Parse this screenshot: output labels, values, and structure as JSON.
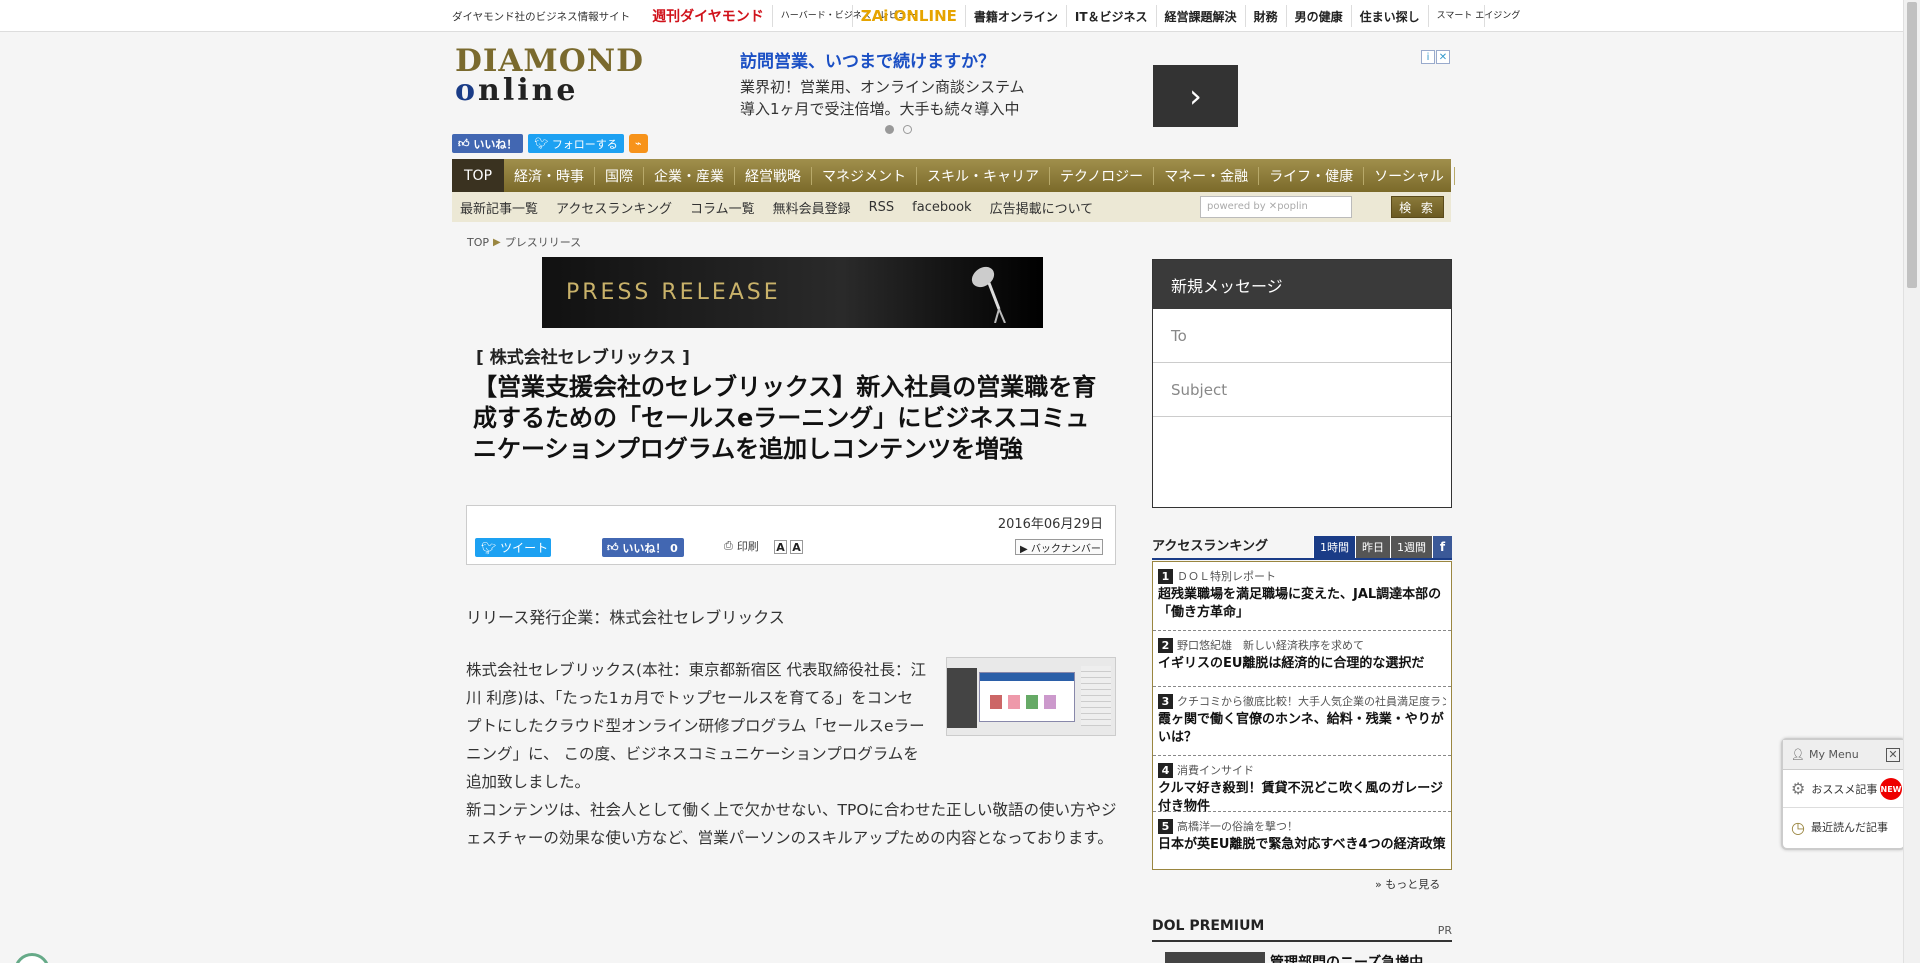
{
  "topbar": {
    "site_label": "ダイヤモンド社のビジネス情報サイト",
    "links": [
      "週刊ダイヤモンド",
      "ハーバード・ビジネス・レビュー",
      "ZAi ONLINE",
      "書籍オンライン",
      "IT＆ビジネス",
      "経営課題解決",
      "財務",
      "男の健康",
      "住まい探し",
      "スマート エイジング"
    ]
  },
  "logo": {
    "line1": "DIAMOND",
    "line2_a": "o",
    "line2_b": "nline"
  },
  "social": {
    "like": "いいね！",
    "follow": "フォローする",
    "rss": "RSS"
  },
  "ad": {
    "headline": "訪問営業、いつまで続けますか？",
    "line1": "業界初！営業用、オンライン商談システム",
    "line2": "導入1ヶ月で受注倍増。大手も続々導入中",
    "arrow": "›",
    "info": "i",
    "close": "✕"
  },
  "nav": {
    "items": [
      "TOP",
      "経済・時事",
      "国際",
      "企業・産業",
      "経営戦略",
      "マネジメント",
      "スキル・キャリア",
      "テクノロジー",
      "マネー・金融",
      "ライフ・健康",
      "ソーシャル"
    ]
  },
  "subnav": {
    "items": [
      "最新記事一覧",
      "アクセスランキング",
      "コラム一覧",
      "無料会員登録",
      "RSS",
      "facebook",
      "広告掲載について"
    ],
    "search_placeholder": "powered by ✕poplin",
    "search_button": "検 索"
  },
  "breadcrumb": {
    "home": "TOP",
    "sep": "▶",
    "current": "プレスリリース"
  },
  "press_banner": "PRESS RELEASE",
  "article": {
    "company": "[ 株式会社セレブリックス ]",
    "title": "【営業支援会社のセレブリックス】新入社員の営業職を育成するための「セールスeラーニング」にビジネスコミュニケーションプログラムを追加しコンテンツを増強",
    "date": "2016年06月29日",
    "tweet": "ツイート",
    "like": "いいね！ 0",
    "print": "印刷",
    "font_a1": "A",
    "font_a2": "A",
    "backnumber": "▶ バックナンバー",
    "issuer": "リリース発行企業：株式会社セレブリックス",
    "p1": "株式会社セレブリックス(本社：東京都新宿区 代表取締役社長：江川 利彦)は、「たった1ヵ月でトップセールスを育てる」をコンセプトにしたクラウド型オンライン研修プログラム「セールスeラーニング」に、 この度、ビジネスコミュニケーションプログラムを追加致しました。",
    "p2": "新コンテンツは、社会人として働く上で欠かせない、TPOに合わせた正しい敬語の使い方やジェスチャーの効果な使い方など、営業パーソンのスキルアップための内容となっております。"
  },
  "message": {
    "title": "新規メッセージ",
    "to": "To",
    "subject": "Subject"
  },
  "ranking": {
    "title": "アクセスランキング",
    "tabs": [
      "1時間",
      "昨日",
      "1週間"
    ],
    "fb": "f",
    "items": [
      {
        "num": "1",
        "series": "ＤＯＬ特別レポート",
        "title": "超残業職場を満足職場に変えた、JAL調達本部の「働き方革命」"
      },
      {
        "num": "2",
        "series": "野口悠紀雄　新しい経済秩序を求めて",
        "title": "イギリスのEU離脱は経済的に合理的な選択だ"
      },
      {
        "num": "3",
        "series": "クチコミから徹底比較！大手人気企業の社員満足度ランキング",
        "title": "霞ヶ関で働く官僚のホンネ、給料・残業・やりがいは？"
      },
      {
        "num": "4",
        "series": "消費インサイド",
        "title": "クルマ好き殺到！賃貸不況どこ吹く風のガレージ付き物件"
      },
      {
        "num": "5",
        "series": "高橋洋一の俗論を撃つ！",
        "title": "日本が英EU離脱で緊急対応すべき4つの経済政策"
      }
    ],
    "more": "» もっと見る"
  },
  "premium": {
    "title": "DOL PREMIUM",
    "pr": "PR",
    "item": "管理部門のニーズ急増中"
  },
  "mymenu": {
    "title": "My Menu",
    "close": "✕",
    "recommended": "おススメ記事",
    "new": "NEW",
    "recent": "最近読んだ記事"
  }
}
